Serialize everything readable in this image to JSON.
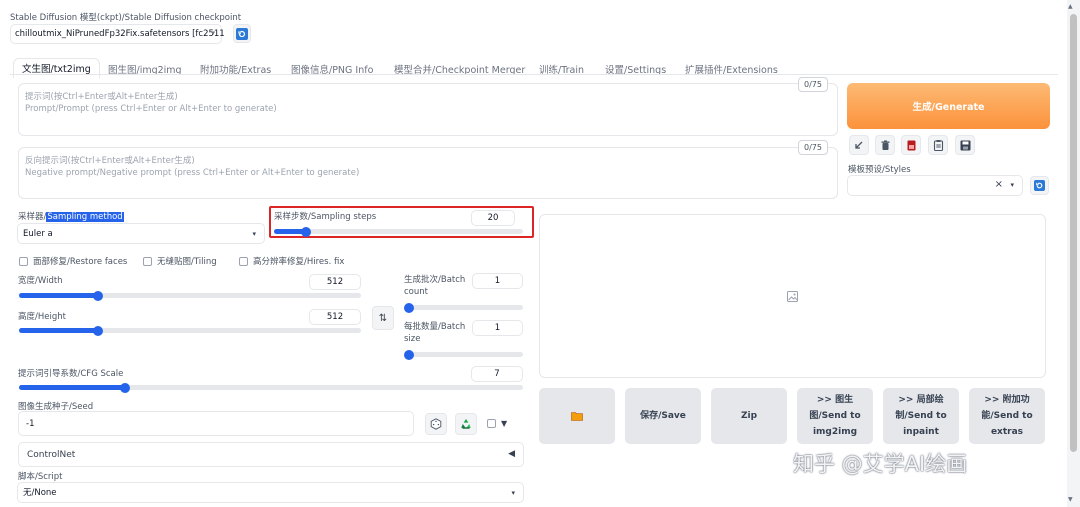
{
  "checkpoint": {
    "label": "Stable Diffusion 模型(ckpt)/Stable Diffusion checkpoint",
    "value": "chilloutmix_NiPrunedFp32Fix.safetensors [fc2511",
    "arrow": "▾"
  },
  "tabs": [
    {
      "label": "文生图/txt2img"
    },
    {
      "label": "图生图/img2img"
    },
    {
      "label": "附加功能/Extras"
    },
    {
      "label": "图像信息/PNG Info"
    },
    {
      "label": "模型合并/Checkpoint Merger"
    },
    {
      "label": "训练/Train"
    },
    {
      "label": "设置/Settings"
    },
    {
      "label": "扩展插件/Extensions"
    }
  ],
  "prompt": {
    "placeholder_line1": "提示词(按Ctrl+Enter或Alt+Enter生成)",
    "placeholder_line2": "Prompt/Prompt (press Ctrl+Enter or Alt+Enter to generate)",
    "counter": "0/75"
  },
  "negative": {
    "placeholder_line1": "反向提示词(按Ctrl+Enter或Alt+Enter生成)",
    "placeholder_line2": "Negative prompt/Negative prompt (press Ctrl+Enter or Alt+Enter to generate)",
    "counter": "0/75"
  },
  "generate_label": "生成/Generate",
  "styles": {
    "label": "模板预设/Styles",
    "clear": "×",
    "arrow": "▾"
  },
  "sampler": {
    "label_prefix": "采样器/",
    "label_highlight": "Sampling method",
    "value": "Euler a",
    "arrow": "▾"
  },
  "steps": {
    "label": "采样步数/Sampling steps",
    "value": "20",
    "fraction": 0.13
  },
  "checkboxes": {
    "restore_faces": "面部修复/Restore faces",
    "tiling": "无缝贴图/Tiling",
    "hires_fix": "高分辨率修复/Hires. fix"
  },
  "width": {
    "label": "宽度/Width",
    "value": "512",
    "fraction": 0.23
  },
  "height": {
    "label": "高度/Height",
    "value": "512",
    "fraction": 0.23
  },
  "swap_icon": "⇅",
  "batch_count": {
    "label_line1": "生成批次/Batch",
    "label_line2": "count",
    "value": "1",
    "fraction": 0.0
  },
  "batch_size": {
    "label_line1": "每批数量/Batch",
    "label_line2": "size",
    "value": "1",
    "fraction": 0.0
  },
  "cfg": {
    "label": "提示词引导系数/CFG Scale",
    "value": "7",
    "fraction": 0.21
  },
  "seed": {
    "label": "图像生成种子/Seed",
    "value": "-1",
    "extra_arrow": "▼"
  },
  "controlnet": {
    "label": "ControlNet",
    "arrow": "◀"
  },
  "script": {
    "label": "脚本/Script",
    "value": "无/None",
    "arrow": "▾"
  },
  "output_buttons": {
    "save": "保存/Save",
    "zip": "Zip",
    "img2img": [
      ">> 图生",
      "图/Send to",
      "img2img"
    ],
    "inpaint": [
      ">> 局部绘",
      "制/Send to",
      "inpaint"
    ],
    "extras": [
      ">> 附加功",
      "能/Send to",
      "extras"
    ]
  },
  "watermark": "知乎 @艾学AI绘画",
  "colors": {
    "accent": "#2563eb",
    "generate_start": "#fdba74",
    "generate_end": "#f97316",
    "highlight_border": "#dc2626"
  }
}
